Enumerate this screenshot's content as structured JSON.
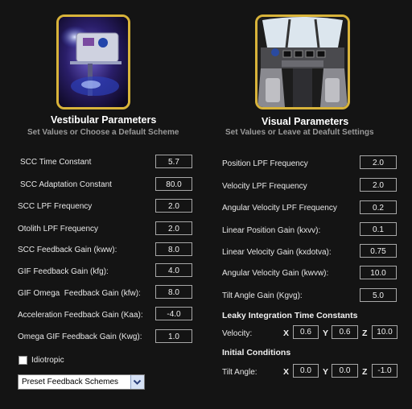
{
  "vestibular": {
    "title": "Vestibular Parameters",
    "subtitle": "Set Values or Choose a Default Scheme",
    "params": [
      {
        "label": "SCC Time Constant",
        "value": "5.7"
      },
      {
        "label": "SCC Adaptation Constant",
        "value": "80.0"
      },
      {
        "label": "SCC LPF Frequency",
        "value": "2.0"
      },
      {
        "label": "Otolith LPF Frequency",
        "value": "2.0"
      },
      {
        "label": "SCC Feedback Gain (kww):",
        "value": "8.0"
      },
      {
        "label": "GIF Feedback Gain (kfg):",
        "value": "4.0"
      },
      {
        "label": "GIF Omega  Feedback Gain (kfw):",
        "value": "8.0"
      },
      {
        "label": "Acceleration Feedback Gain (Kaa):",
        "value": "-4.0"
      },
      {
        "label": "Omega GIF Feedback Gain (Kwg):",
        "value": "1.0"
      }
    ],
    "idiotropic_label": "Idiotropic",
    "idiotropic_checked": false,
    "scheme_select": "Preset Feedback Schemes"
  },
  "visual": {
    "title": "Visual Parameters",
    "subtitle": "Set Values or Leave at Deafult Settings",
    "params": [
      {
        "label": "Position LPF Frequency",
        "value": "2.0"
      },
      {
        "label": "Velocity LPF Frequency",
        "value": "2.0"
      },
      {
        "label": "Angular Velocity LPF Frequency",
        "value": "0.2"
      },
      {
        "label": "Linear Position Gain (kxvv):",
        "value": "0.1"
      },
      {
        "label": "Linear Velocity Gain (kxdotva):",
        "value": "0.75"
      },
      {
        "label": "Angular Velocity Gain (kwvw):",
        "value": "10.0"
      },
      {
        "label": "Tilt Angle Gain (Kgvg):",
        "value": "5.0"
      }
    ],
    "leaky_title": "Leaky Integration Time Constants",
    "velocity": {
      "label": "Velocity:",
      "x_label": "X",
      "x": "0.6",
      "y_label": "Y",
      "y": "0.6",
      "z_label": "Z",
      "z": "10.0"
    },
    "initial_title": "Initial Conditions",
    "tilt": {
      "label": "Tilt Angle:",
      "x_label": "X",
      "x": "0.0",
      "y_label": "Y",
      "y": "0.0",
      "z_label": "Z",
      "z": "-1.0"
    }
  },
  "colors": {
    "background": "#141414",
    "frame": "#d8b33a",
    "subtitle": "#9a9a9a"
  },
  "icons": {
    "vestibular_image": "centrifuge-photo",
    "visual_image": "cockpit-photo",
    "select_arrow": "chevron-down-icon"
  }
}
